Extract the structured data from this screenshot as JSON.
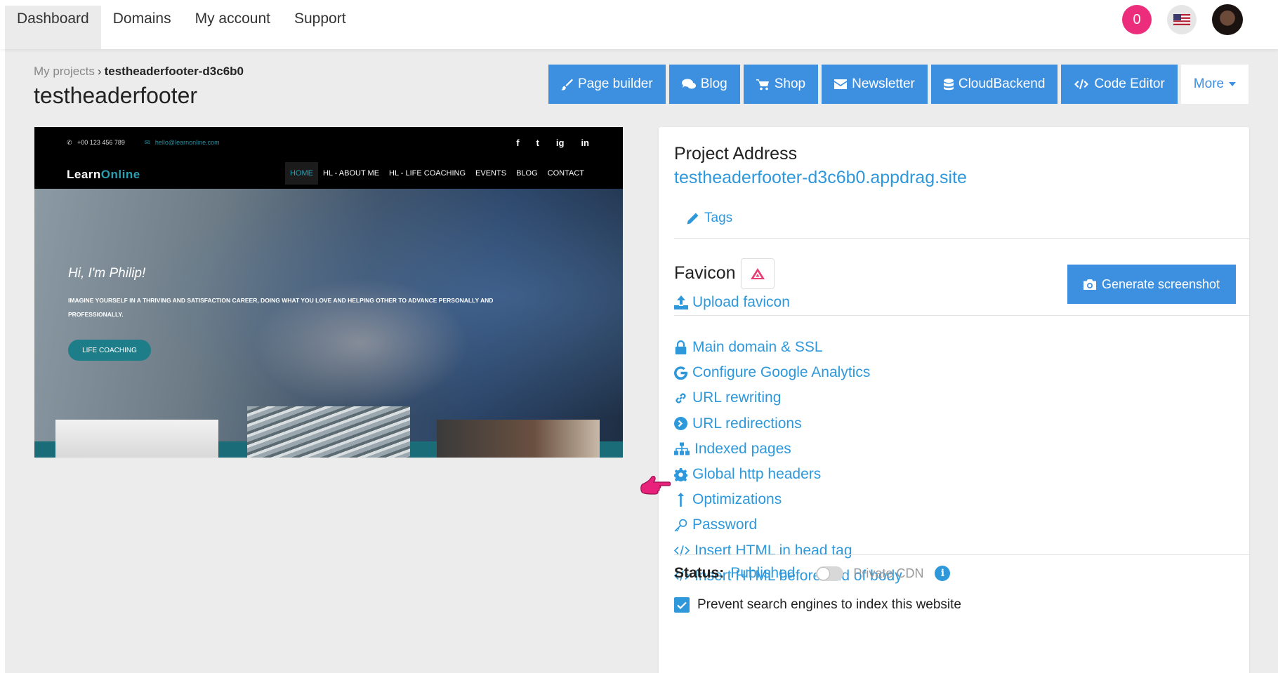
{
  "nav": {
    "tabs": [
      "Dashboard",
      "Domains",
      "My account",
      "Support"
    ],
    "active_tab": "Dashboard",
    "notification_count": "0",
    "language_flag": "us-flag-icon",
    "avatar": "user-avatar"
  },
  "breadcrumb": {
    "parent": "My projects",
    "current": "testheaderfooter-d3c6b0"
  },
  "page_title": "testheaderfooter",
  "toolbar": {
    "page_builder": "Page builder",
    "blog": "Blog",
    "shop": "Shop",
    "newsletter": "Newsletter",
    "cloudbackend": "CloudBackend",
    "code_editor": "Code Editor",
    "more": "More"
  },
  "preview": {
    "phone": "+00 123 456 789",
    "email": "hello@learnonline.com",
    "social": [
      "f",
      "t",
      "ig",
      "in"
    ],
    "logo_part1": "Learn",
    "logo_part2": "Online",
    "menu": [
      "HOME",
      "HL - ABOUT ME",
      "HL - LIFE COACHING",
      "EVENTS",
      "BLOG",
      "CONTACT"
    ],
    "hero_title": "Hi, I'm Philip!",
    "hero_subtitle": "IMAGINE YOURSELF IN A THRIVING AND SATISFACTION CAREER, DOING WHAT YOU LOVE AND HELPING OTHER TO ADVANCE PERSONALLY AND PROFESSIONALLY.",
    "cta": "LIFE COACHING"
  },
  "panel": {
    "project_address_label": "Project Address",
    "project_url": "testheaderfooter-d3c6b0.appdrag.site",
    "tags": "Tags",
    "favicon_label": "Favicon",
    "upload_favicon": "Upload favicon",
    "generate_screenshot": "Generate screenshot",
    "links": {
      "main_domain": "Main domain & SSL",
      "google_analytics": "Configure Google Analytics",
      "url_rewriting": "URL rewriting",
      "url_redirections": "URL redirections",
      "indexed_pages": "Indexed pages",
      "http_headers": "Global http headers",
      "optimizations": "Optimizations",
      "password": "Password",
      "html_head": "Insert HTML in head tag",
      "html_body": "Insert HTML before end of body"
    },
    "status_label": "Status:",
    "status_value": "Published",
    "private_cdn": "Private CDN",
    "private_cdn_enabled": false,
    "prevent_indexing": "Prevent search engines to index this website",
    "prevent_indexing_checked": true
  },
  "colors": {
    "accent": "#3d8fe0",
    "link": "#2e98db",
    "notification": "#ec2d7c"
  }
}
